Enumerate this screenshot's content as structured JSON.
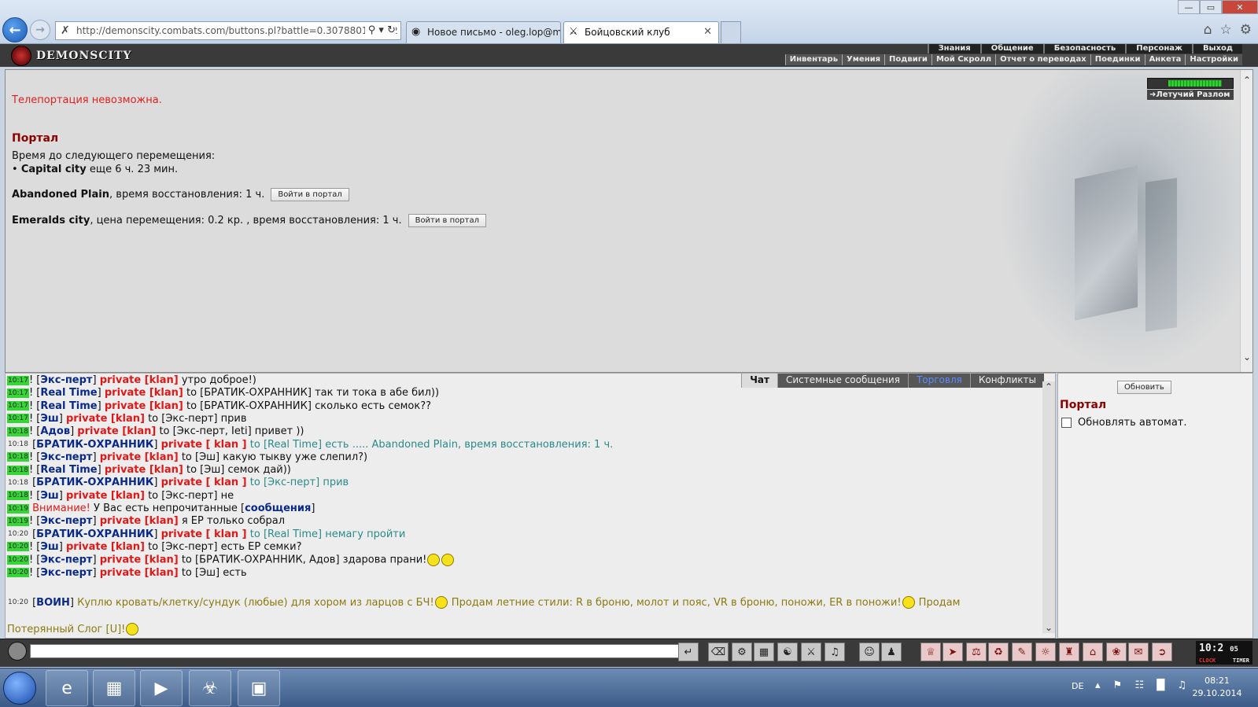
{
  "browser": {
    "address": "http://demonscity.combats.com/buttons.pl?battle=0.307880103732",
    "tabs": [
      {
        "title": "Новое письмо - oleg.lop@ma..."
      },
      {
        "title": "Бойцовский клуб"
      }
    ]
  },
  "game": {
    "logo_text": "DEMONSCITY",
    "menu_top": [
      "Знания",
      "Общение",
      "Безопасность",
      "Персонаж",
      "Выход"
    ],
    "menu_bottom": [
      "Инвентарь",
      "Умения",
      "Подвиги",
      "Мой Скролл",
      "Отчет о переводах",
      "Поединки",
      "Анкета",
      "Настройки"
    ],
    "location": {
      "name": "Летучий Разлом",
      "health_fraction": 0.85
    }
  },
  "main": {
    "teleport_msg": "Телепортация невозможна.",
    "portal_title": "Портал",
    "next_time_label": "Время до следующего перемещения:",
    "capital_city": "Capital city",
    "capital_rest": " еще 6 ч. 23 мин.",
    "abandoned_name": "Abandoned Plain",
    "abandoned_rest": ", время восстановления: 1 ч.",
    "emeralds_name": "Emeralds city",
    "emeralds_rest": ", цена перемещения: 0.2 кр. , время восстановления: 1 ч.",
    "enter_portal_label": "Войти в портал"
  },
  "chat": {
    "tabs": [
      "Чат",
      "Системные сообщения",
      "Торговля",
      "Конфликты"
    ],
    "lines": [
      {
        "t": "10:17",
        "p": true,
        "who": "Экс-перт",
        "to": "",
        "msg": "утро доброе!)"
      },
      {
        "t": "10:17",
        "p": true,
        "who": "Real Time",
        "to": "БРАТИК-ОХРАННИК",
        "msg": "так ти тока в абе бил))"
      },
      {
        "t": "10:17",
        "p": true,
        "who": "Real Time",
        "to": "БРАТИК-ОХРАННИК",
        "msg": "сколько есть семок??"
      },
      {
        "t": "10:17",
        "p": true,
        "who": "Эш",
        "to": "Экс-перт",
        "msg": "прив"
      },
      {
        "t": "10:18",
        "p": true,
        "who": "Адов",
        "to": "Экс-перт, Ieti",
        "msg": "привет ))"
      },
      {
        "t": "10:18",
        "p": false,
        "who": "БРАТИК-ОХРАННИК",
        "to": "Real Time",
        "msg": "есть ..... Abandoned Plain, время восстановления: 1 ч."
      },
      {
        "t": "10:18",
        "p": true,
        "who": "Экс-перт",
        "to": "Эш",
        "msg": "какую тыкву уже слепил?)"
      },
      {
        "t": "10:18",
        "p": true,
        "who": "Real Time",
        "to": "Эш",
        "msg": "семок дай))"
      },
      {
        "t": "10:18",
        "p": false,
        "who": "БРАТИК-ОХРАННИК",
        "to": "Экс-перт",
        "msg": "прив"
      },
      {
        "t": "10:18",
        "p": true,
        "who": "Эш",
        "to": "Экс-перт",
        "msg": "не"
      },
      {
        "t": "10:19",
        "p": true,
        "who": "",
        "to": "",
        "msg": ""
      },
      {
        "t": "10:19",
        "p": true,
        "who": "Экс-перт",
        "to": "",
        "msg": "я ЕР только собрал"
      },
      {
        "t": "10:20",
        "p": false,
        "who": "БРАТИК-ОХРАННИК",
        "to": "Real Time",
        "msg": "немагу пройти"
      },
      {
        "t": "10:20",
        "p": true,
        "who": "Эш",
        "to": "Экс-перт",
        "msg": "есть ЕР семки?"
      },
      {
        "t": "10:20",
        "p": true,
        "who": "Экс-перт",
        "to": "БРАТИК-ОХРАННИК, Адов",
        "msg": "здарова прани!"
      },
      {
        "t": "10:20",
        "p": true,
        "who": "Экс-перт",
        "to": "Эш",
        "msg": "есть"
      }
    ],
    "warn_prefix": "Внимание!",
    "warn_text": " У Вас есть непрочитанные [",
    "warn_link": "сообщения",
    "warn_end": "]",
    "private_klan": "private [klan]",
    "private_space_klan": "private [ klan ]",
    "to_word": "to",
    "trade_line": {
      "t": "10:20",
      "who": "ВОИН",
      "msg1": "Куплю кровать/клетку/сундук (любые) для хором из ларцов с БЧ!",
      "msg2": "Продам летние стили: R в броню, молот и пояс, VR в броню, поножи, ER в поножи!",
      "msg3": "Продам",
      "msg4": "Потерянный Слог [U]!"
    }
  },
  "side": {
    "refresh_label": "Обновить",
    "portal_title": "Портал",
    "auto_refresh_label": "Обновлять автомат."
  },
  "clock": {
    "time": "10:2",
    "suffix": "05",
    "clock_label": "CLOCK",
    "timer_label": "TIMER"
  },
  "taskbar": {
    "lang": "DE",
    "time": "08:21",
    "date": "29.10.2014"
  }
}
